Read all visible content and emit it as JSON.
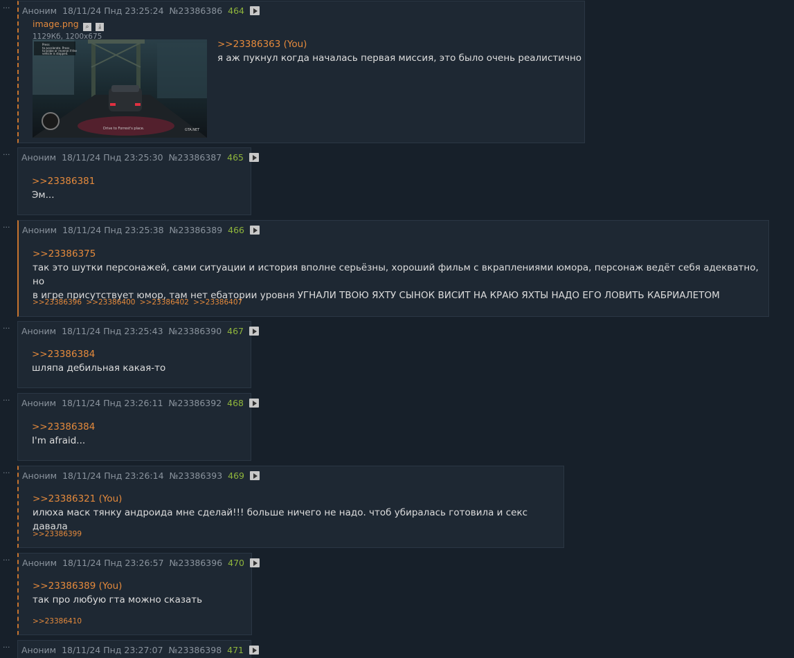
{
  "posts": [
    {
      "author": "Аноним",
      "date": "18/11/24 Пнд 23:25:24",
      "id": "№23386386",
      "num": "464",
      "file": {
        "name": "image.png",
        "meta": "1129Кб, 1200x675"
      },
      "reply_link": ">>23386363 (You)",
      "text": "я аж пукнул когда началась первая миссия, это было очень реалистично",
      "game_text": {
        "hint1": "Press",
        "hint2": "to accelerate. Press",
        "hint3": "to brake or reverse if the",
        "hint4": "vehicle is stopped.",
        "subtitle": "Drive to Forrest's place.",
        "logo": "GTA.NET"
      }
    },
    {
      "author": "Аноним",
      "date": "18/11/24 Пнд 23:25:30",
      "id": "№23386387",
      "num": "465",
      "reply_link": ">>23386381",
      "text": "Эм..."
    },
    {
      "author": "Аноним",
      "date": "18/11/24 Пнд 23:25:38",
      "id": "№23386389",
      "num": "466",
      "reply_link": ">>23386375",
      "text_line1": "так это шутки персонажей, сами ситуации и история вполне серьёзны, хороший фильм с вкраплениями юмора, персонаж ведёт себя адекватно, но",
      "text_line2": "в игре присутствует юмор, там нет ебатории уровня УГНАЛИ ТВОЮ ЯХТУ СЫНОК ВИСИТ НА КРАЮ ЯХТЫ НАДО ЕГО ЛОВИТЬ КАБРИАЛЕТОМ",
      "answers": [
        ">>23386396",
        ">>23386400",
        ">>23386402",
        ">>23386407"
      ]
    },
    {
      "author": "Аноним",
      "date": "18/11/24 Пнд 23:25:43",
      "id": "№23386390",
      "num": "467",
      "reply_link": ">>23386384",
      "text": "шляпа дебильная какая-то"
    },
    {
      "author": "Аноним",
      "date": "18/11/24 Пнд 23:26:11",
      "id": "№23386392",
      "num": "468",
      "reply_link": ">>23386384",
      "text": "I'm afraid..."
    },
    {
      "author": "Аноним",
      "date": "18/11/24 Пнд 23:26:14",
      "id": "№23386393",
      "num": "469",
      "reply_link": ">>23386321 (You)",
      "text": "илюха маск тянку андроида мне сделай!!! больше ничего не надо. чтоб убиралась готовила и секс давала",
      "answers": [
        ">>23386399"
      ]
    },
    {
      "author": "Аноним",
      "date": "18/11/24 Пнд 23:26:57",
      "id": "№23386396",
      "num": "470",
      "reply_link": ">>23386389 (You)",
      "text": "так про любую гта можно сказать",
      "answers": [
        ">>23386410"
      ]
    },
    {
      "author": "Аноним",
      "date": "18/11/24 Пнд 23:27:07",
      "id": "№23386398",
      "num": "471"
    }
  ],
  "menu_dots": "⋮",
  "icons": {
    "search": "search-icon",
    "download": "download-icon",
    "play": "play-icon",
    "menu": "dots-menu-icon"
  },
  "colors": {
    "bg": "#17202a",
    "post_bg": "#1e2833",
    "link": "#e58a3c",
    "num": "#8fb53c",
    "meta": "#8b949e"
  }
}
